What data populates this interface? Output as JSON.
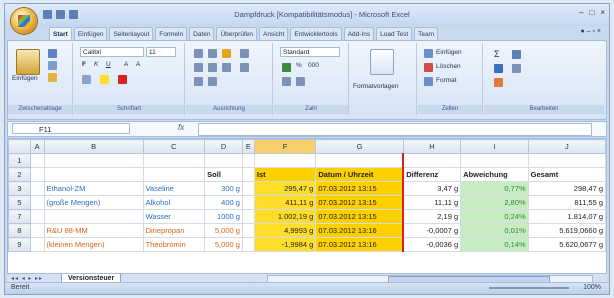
{
  "window": {
    "title": "Dampfdruck [Kompatibilitätsmodus] - Microsoft Excel",
    "controls": [
      "–",
      "□",
      "×"
    ]
  },
  "ribbon_tabs": [
    "Start",
    "Einfügen",
    "Seitenlayout",
    "Formeln",
    "Daten",
    "Überprüfen",
    "Ansicht",
    "Entwicklertools",
    "Add-Ins",
    "Load Test",
    "Team"
  ],
  "ribbon": {
    "paste_label": "Einfügen",
    "font_name": "Calibri",
    "font_size": "11",
    "number_format": "Standard",
    "format_templates_label": "Formatvorlagen",
    "insert_label": "Einfügen",
    "delete_label": "Löschen",
    "format_label": "Format",
    "groups": [
      "Zwischenablage",
      "Schriftart",
      "Ausrichtung",
      "Zahl",
      "Zellen",
      "Bearbeiten"
    ]
  },
  "formula_bar": {
    "name_box": "F11",
    "fx": "fx",
    "formula": ""
  },
  "columns": [
    "",
    "A",
    "B",
    "C",
    "D",
    "E",
    "F",
    "G",
    "H",
    "I",
    "J"
  ],
  "rows": [
    {
      "num": "1",
      "cells": [
        "",
        "",
        "",
        "",
        "",
        "",
        "",
        "",
        "",
        ""
      ]
    },
    {
      "num": "2",
      "header": true,
      "cells": [
        "",
        "",
        "",
        "Soll",
        "",
        "Ist",
        "Datum / Uhrzeit",
        "Differenz",
        "Abweichung",
        "Gesamt"
      ]
    },
    {
      "num": "3",
      "cells": [
        "",
        "Ethanol-ZM",
        "Vaseline",
        "300 g",
        "",
        "295,47 g",
        "07.03.2012 13:15",
        "3,47 g",
        "0,77%",
        "298,47 g"
      ]
    },
    {
      "num": "5",
      "cells": [
        "",
        "(große Mengen)",
        "Alkohol",
        "400 g",
        "",
        "411,11 g",
        "07.03.2012 13:15",
        "11,11 g",
        "2,80%",
        "811,55 g"
      ]
    },
    {
      "num": "7",
      "cells": [
        "",
        "",
        "Wasser",
        "1000 g",
        "",
        "1.002,19 g",
        "07.03.2012 13:15",
        "2,19 g",
        "0,24%",
        "1.814,07 g"
      ]
    },
    {
      "num": "8",
      "cells": [
        "",
        "R&U 88-MM",
        "Dinepropan",
        "5,000 g",
        "",
        "4,9993 g",
        "07.03.2012 13:16",
        "-0,0007 g",
        "0,01%",
        "5.619,0660 g"
      ]
    },
    {
      "num": "9",
      "cells": [
        "",
        "(kleinen Mengen)",
        "Theobromin",
        "5,000 g",
        "",
        "-1,9984 g",
        "07.03.2012 13:16",
        "-0,0036 g",
        "0,14%",
        "5.620,0677 g"
      ]
    }
  ],
  "sheet_tabs": [
    "Versionsteuer"
  ],
  "sheet_nav": "◂◂ ◂ ▸ ▸▸",
  "status": {
    "text": "Bereit",
    "zoom": "100%"
  }
}
